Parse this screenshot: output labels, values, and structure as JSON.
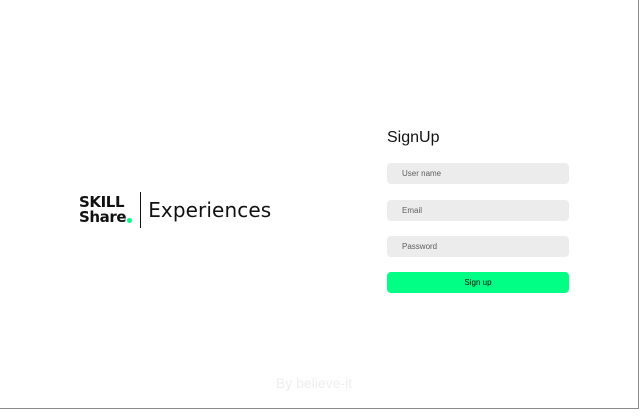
{
  "brand": {
    "logo_line1": "SKILL",
    "logo_line2": "Share",
    "product_name": "Experiences",
    "accent_color": "#00ff84"
  },
  "signup": {
    "title": "SignUp",
    "username_placeholder": "User name",
    "email_placeholder": "Email",
    "password_placeholder": "Password",
    "submit_label": "Sign up"
  },
  "footer": {
    "credit": "By believe-it"
  }
}
